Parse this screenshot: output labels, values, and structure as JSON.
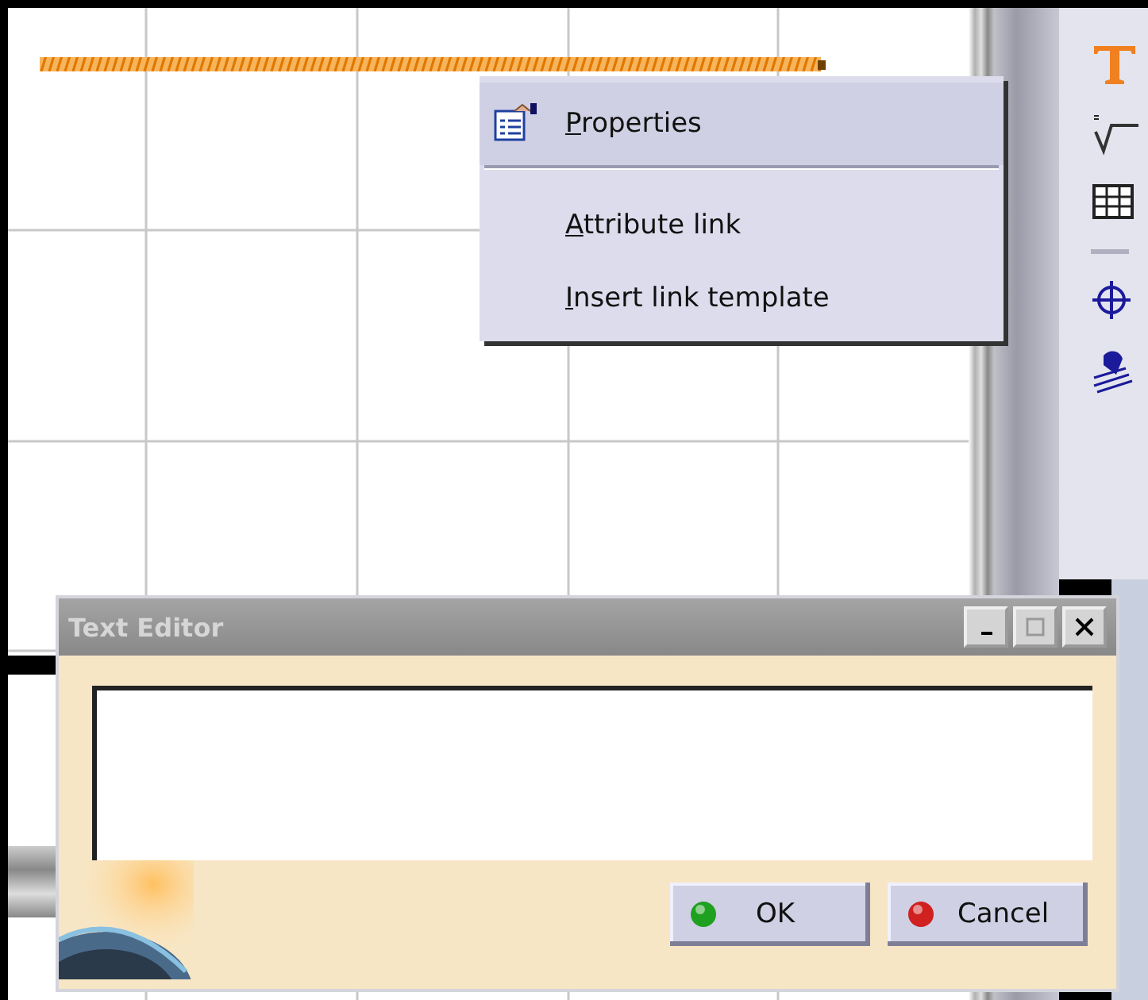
{
  "context_menu": {
    "items": [
      {
        "label": "Properties",
        "kind": "icon",
        "selected": true
      },
      {
        "label": "Attribute link",
        "kind": "plain",
        "selected": false
      },
      {
        "label": "Insert link template",
        "kind": "plain",
        "selected": false
      }
    ]
  },
  "dialog": {
    "title": "Text Editor",
    "buttons": [
      {
        "label": "OK",
        "kind": "ok"
      },
      {
        "label": "Cancel",
        "kind": "cancel"
      }
    ]
  }
}
